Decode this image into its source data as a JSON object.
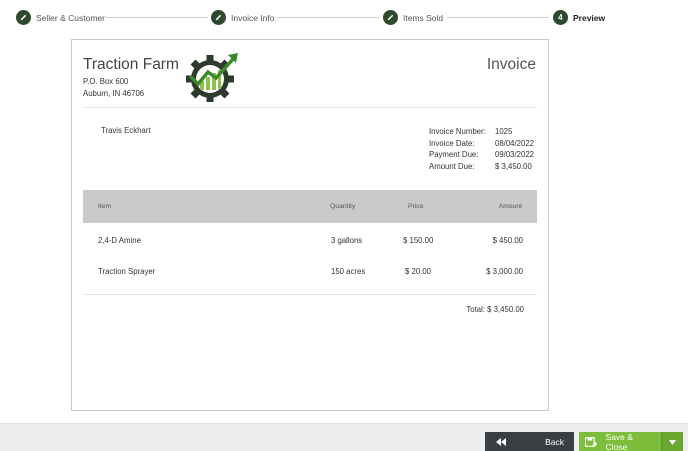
{
  "stepper": {
    "steps": [
      {
        "label": "Seller & Customer",
        "icon": "pencil-icon",
        "state": "complete"
      },
      {
        "label": "Invoice Info",
        "icon": "pencil-icon",
        "state": "complete"
      },
      {
        "label": "Items Sold",
        "icon": "pencil-icon",
        "state": "complete"
      },
      {
        "label": "Preview",
        "number": "4",
        "state": "active"
      }
    ]
  },
  "invoice": {
    "company": {
      "name": "Traction Farm",
      "address_line1": "P.O. Box 600",
      "address_line2": "Auburn, IN 46706",
      "logo": "gear-growth-logo"
    },
    "title": "Invoice",
    "customer": "Travis Eckhart",
    "meta": [
      {
        "label": "Invoice Number:",
        "value": "1025"
      },
      {
        "label": "Invoice Date:",
        "value": "08/04/2022"
      },
      {
        "label": "Payment Due:",
        "value": "09/03/2022"
      },
      {
        "label": "Amount Due:",
        "value": "$ 3,450.00"
      }
    ],
    "table": {
      "headers": {
        "item": "Item",
        "quantity": "Quantity",
        "price": "Price",
        "amount": "Amount"
      },
      "rows": [
        {
          "item": "2,4-D Amine",
          "quantity": "3 gallons",
          "price": "$ 150.00",
          "amount": "$ 450.00"
        },
        {
          "item": "Traction Sprayer",
          "quantity": "150 acres",
          "price": "$ 20.00",
          "amount": "$ 3,000.00"
        }
      ]
    },
    "total": "Total: $ 3,450.00"
  },
  "footer": {
    "back_label": "Back",
    "save_label": "Save & Close"
  },
  "colors": {
    "step_dark": "#2e4a2e",
    "save_green": "#7cbd3b",
    "back_dark": "#3b3f43",
    "table_header": "#c9cbc9",
    "logo_green": "#3a8a2c"
  }
}
